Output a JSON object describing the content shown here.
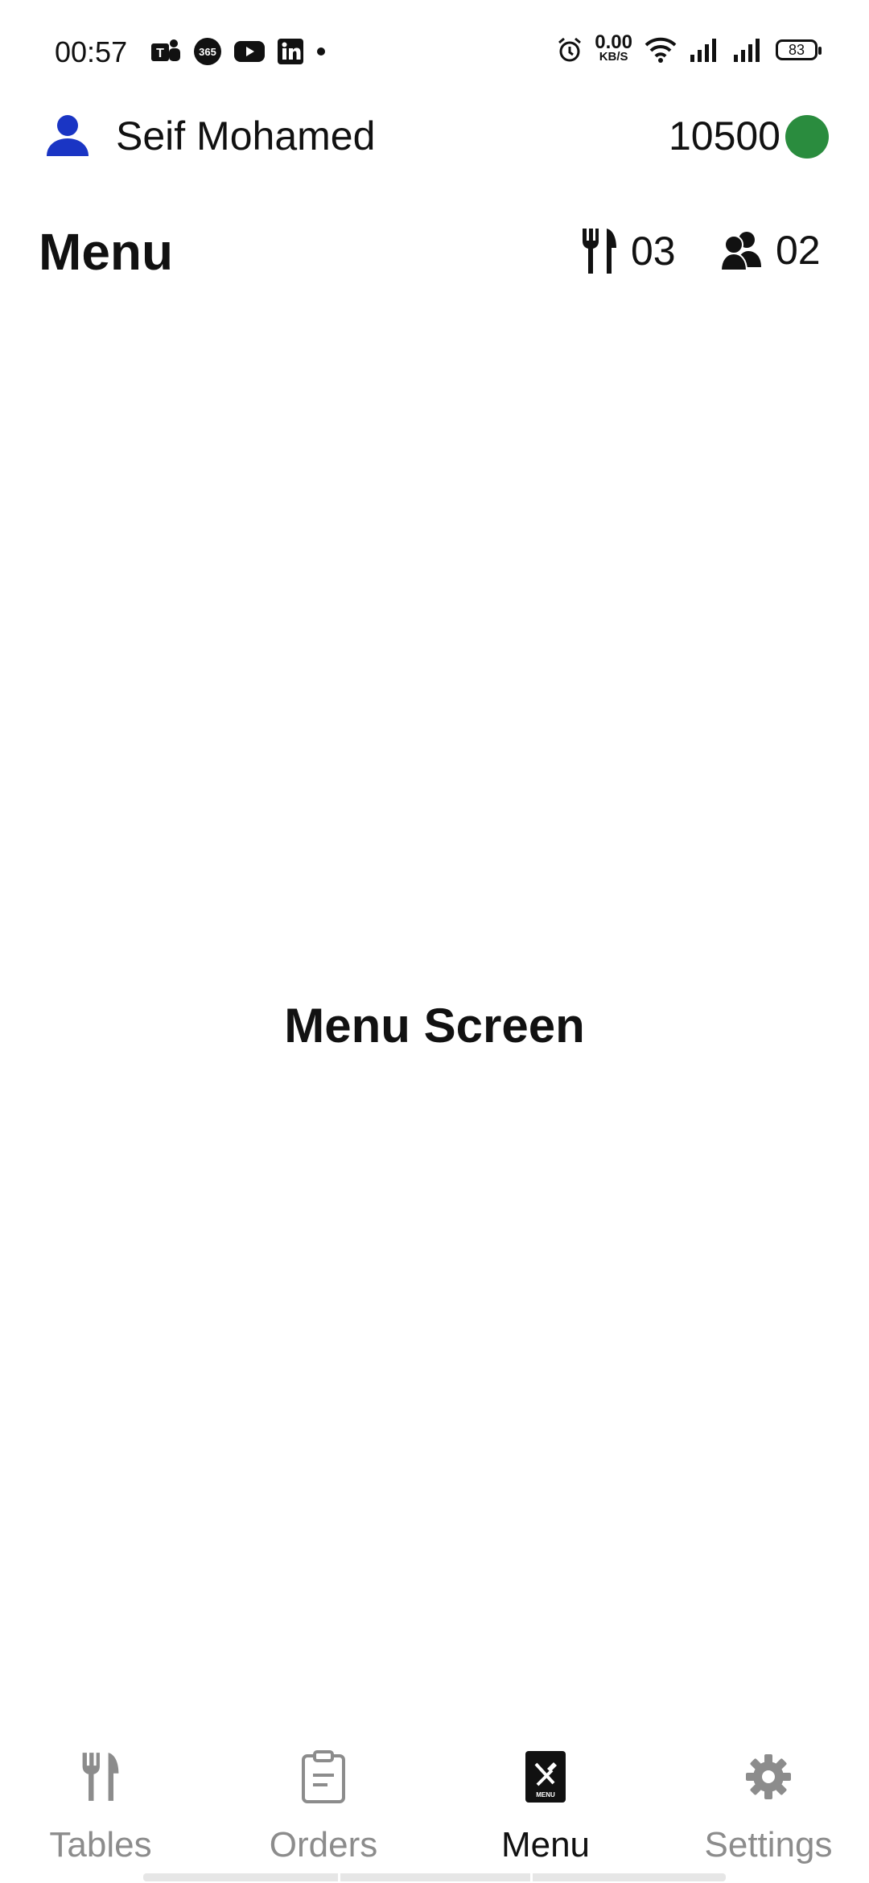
{
  "status_bar": {
    "time": "00:57",
    "net_speed_value": "0.00",
    "net_speed_unit": "KB/S",
    "battery": "83",
    "notification_icons": [
      "teams-icon",
      "office365-icon",
      "youtube-icon",
      "linkedin-icon",
      "more-dot-icon"
    ],
    "system_icons": [
      "alarm-icon",
      "wifi-icon",
      "signal-icon",
      "signal-icon"
    ]
  },
  "user": {
    "name": "Seif Mohamed",
    "points": "10500",
    "status_color": "#2a8c3e",
    "avatar_color": "#1a35c4"
  },
  "header": {
    "title": "Menu",
    "tables_count": "03",
    "guests_count": "02"
  },
  "content": {
    "placeholder": "Menu Screen"
  },
  "bottom_nav": {
    "items": [
      {
        "label": "Tables",
        "icon": "fork-knife-icon",
        "active": false
      },
      {
        "label": "Orders",
        "icon": "clipboard-icon",
        "active": false
      },
      {
        "label": "Menu",
        "icon": "menu-book-icon",
        "active": true
      },
      {
        "label": "Settings",
        "icon": "gear-icon",
        "active": false
      }
    ]
  }
}
